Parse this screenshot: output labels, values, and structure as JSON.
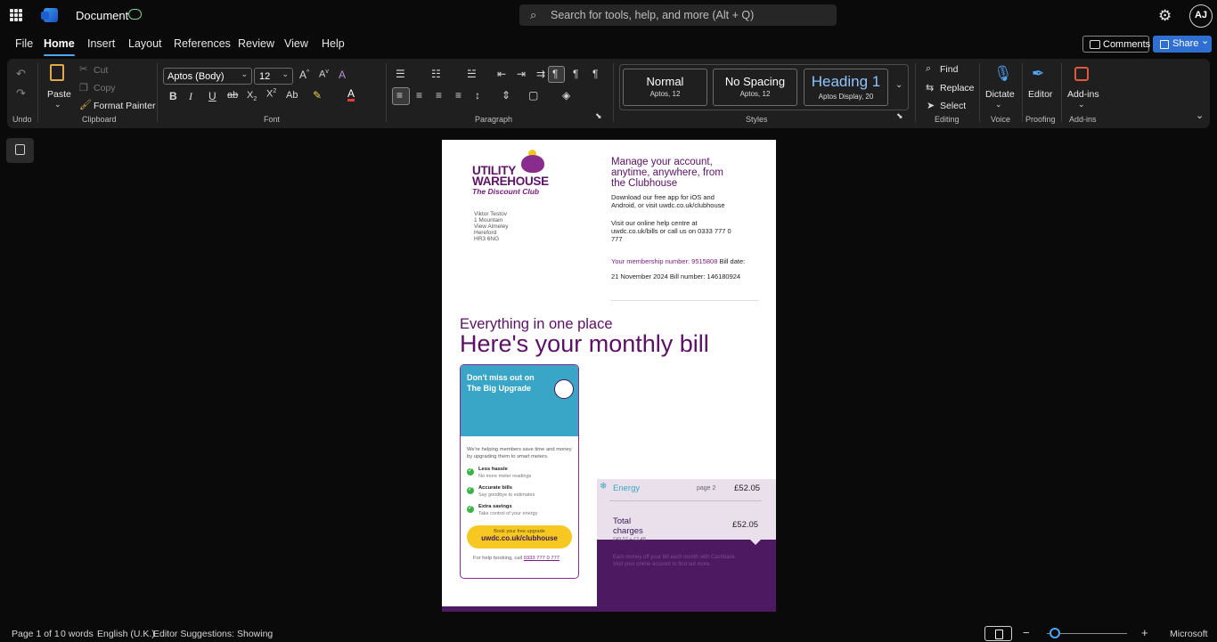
{
  "titlebar": {
    "app_name": "Word",
    "doc_title": "Document",
    "search_placeholder": "Search for tools, help, and more (Alt + Q)",
    "avatar_initials": "AJ"
  },
  "menubar": {
    "tabs": [
      {
        "label": "File"
      },
      {
        "label": "Home"
      },
      {
        "label": "Insert"
      },
      {
        "label": "Layout"
      },
      {
        "label": "References"
      },
      {
        "label": "Review"
      },
      {
        "label": "View"
      },
      {
        "label": "Help"
      }
    ],
    "active_tab": "Home",
    "comments_label": "Comments",
    "share_label": "Share"
  },
  "ribbon": {
    "undo_group": "Undo",
    "clipboard": {
      "paste": "Paste",
      "cut": "Cut",
      "copy": "Copy",
      "format_painter": "Format Painter",
      "label": "Clipboard"
    },
    "font": {
      "family": "Aptos (Body)",
      "size": "12",
      "label": "Font"
    },
    "paragraph_label": "Paragraph",
    "styles": {
      "label": "Styles",
      "items": [
        {
          "name": "Normal",
          "sub": "Aptos, 12"
        },
        {
          "name": "No Spacing",
          "sub": "Aptos, 12"
        },
        {
          "name": "Heading 1",
          "sub": "Aptos Display, 20"
        }
      ]
    },
    "editing": {
      "find": "Find",
      "replace": "Replace",
      "select": "Select",
      "label": "Editing"
    },
    "voice": {
      "dictate": "Dictate",
      "label": "Voice"
    },
    "proofing": {
      "editor": "Editor",
      "label": "Proofing"
    },
    "addins": {
      "addins": "Add-ins",
      "label": "Add-ins"
    }
  },
  "document": {
    "logo_line1": "UTILITY",
    "logo_line2": "WAREHOUSE",
    "logo_tagline": "The Discount Club",
    "address": [
      "Viktor Testov",
      "1 Mountain",
      "View Almeley",
      "Hereford",
      "HR3 6NG"
    ],
    "manage_heading": [
      "Manage your account,",
      "anytime, anywhere, from",
      "the Clubhouse"
    ],
    "download_text": [
      "Download our free app for iOS and",
      "Android, or visit uwdc.co.uk/clubhouse"
    ],
    "visit_text": [
      "Visit our online help centre at",
      "uwdc.co.uk/bills or call us on 0333 777 0",
      "777"
    ],
    "membership_prefix": "Your membership number: 9515808",
    "bill_date_label": " Bill date:",
    "bill_date_line": "21 November 2024 Bill number: 146180924",
    "everything": "Everything in one place",
    "monthly_bill": "Here's your monthly bill",
    "promo": {
      "title_line1": "Don't miss out on",
      "title_line2": "The Big Upgrade",
      "body": "We're helping members save time and money by upgrading them to smart meters.",
      "items": [
        {
          "title": "Less hassle",
          "sub": "No more meter readings"
        },
        {
          "title": "Accurate bills",
          "sub": "Say goodbye to estimates"
        },
        {
          "title": "Extra savings",
          "sub": "Take control of your energy"
        }
      ],
      "button_line1": "Book your free upgrade",
      "button_line2": "uwdc.co.uk/clubhouse",
      "help_prefix": "For help booking, call ",
      "help_number": "0333 777 0 777"
    },
    "energy": {
      "name": "Energy",
      "page": "page 2",
      "amount": "£52.05",
      "total_label_1": "Total",
      "total_label_2": "charges",
      "total_amount": "£52.05",
      "total_sub": "£49.57 + £2.48",
      "dark_text": "Earn money off your bill each month with Cashback. Visit your online account to find out more."
    }
  },
  "statusbar": {
    "page": "Page 1 of 1",
    "words": "0 words",
    "language": "English (U.K.)",
    "editor": "Editor Suggestions: Showing",
    "brand": "Microsoft"
  }
}
